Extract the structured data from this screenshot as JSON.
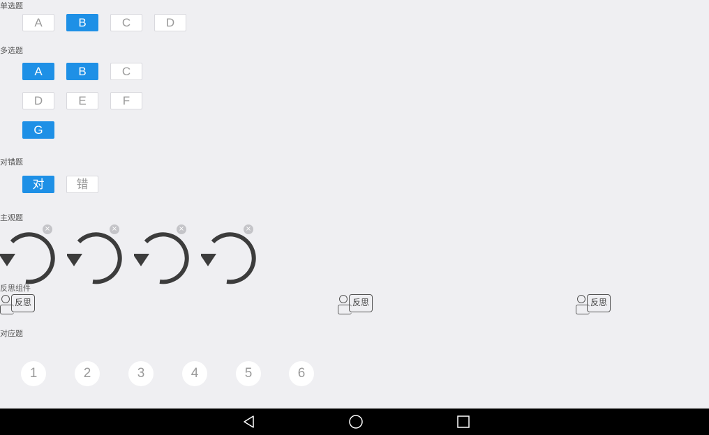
{
  "single_choice": {
    "title": "单选题",
    "options": [
      {
        "label": "A",
        "selected": false
      },
      {
        "label": "B",
        "selected": true
      },
      {
        "label": "C",
        "selected": false
      },
      {
        "label": "D",
        "selected": false
      }
    ]
  },
  "multi_choice": {
    "title": "多选题",
    "options": [
      {
        "label": "A",
        "selected": true
      },
      {
        "label": "B",
        "selected": true
      },
      {
        "label": "C",
        "selected": false
      },
      {
        "label": "D",
        "selected": false
      },
      {
        "label": "E",
        "selected": false
      },
      {
        "label": "F",
        "selected": false
      },
      {
        "label": "G",
        "selected": true
      }
    ]
  },
  "true_false": {
    "title": "对错题",
    "options": [
      {
        "label": "对",
        "selected": true
      },
      {
        "label": "错",
        "selected": false
      }
    ]
  },
  "subjective": {
    "title": "主观题",
    "items": [
      "replay-icon",
      "replay-icon",
      "replay-icon",
      "replay-icon"
    ],
    "remove_symbol": "×"
  },
  "reflection": {
    "title": "反思组件",
    "buttons": [
      "反思",
      "反思",
      "反思"
    ]
  },
  "matching": {
    "title": "对应题",
    "numbers": [
      "1",
      "2",
      "3",
      "4",
      "5",
      "6"
    ]
  },
  "colors": {
    "accent": "#1e90e6",
    "background": "#efeff2",
    "navbar": "#000000"
  },
  "navbar": {
    "icons": [
      "back-icon",
      "home-icon",
      "recents-icon"
    ]
  }
}
